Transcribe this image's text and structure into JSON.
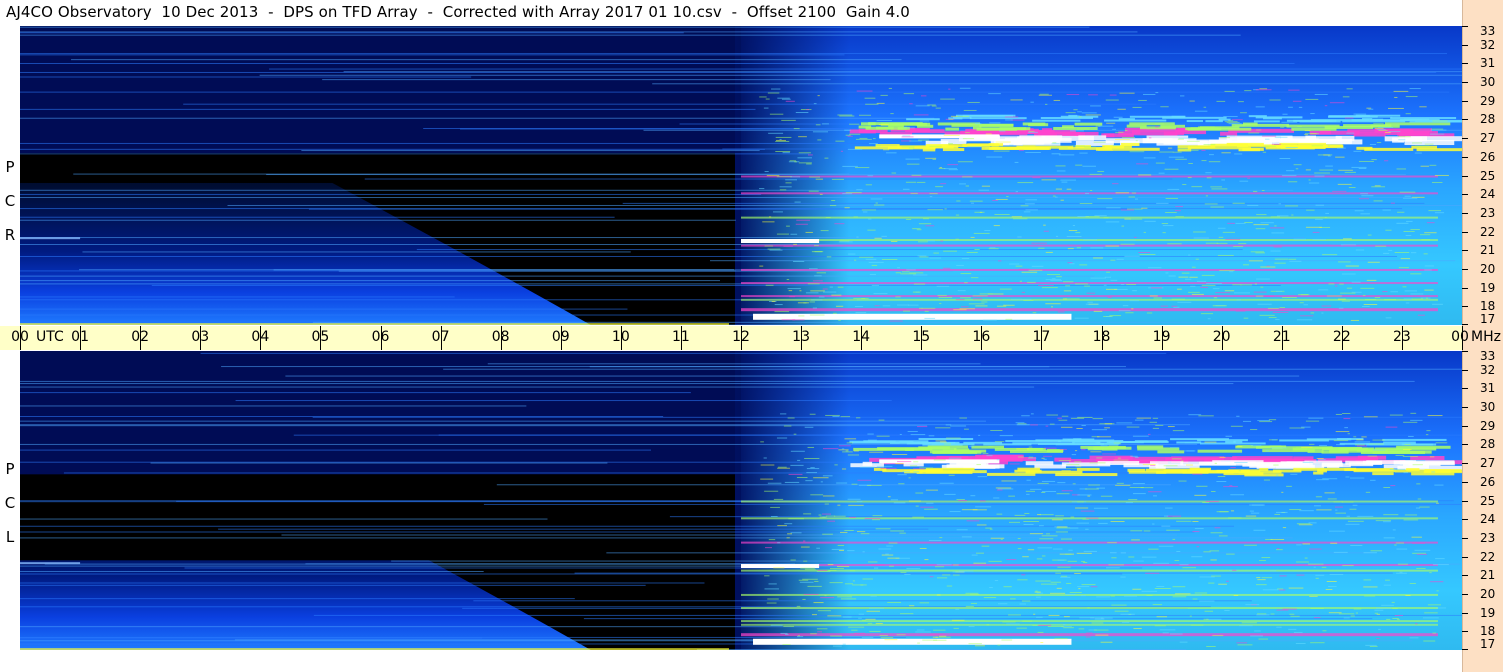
{
  "title": "AJ4CO Observatory  10 Dec 2013  -  DPS on TFD Array  -  Corrected with Array 2017 01 10.csv  -  Offset 2100  Gain 4.0",
  "chart_data": [
    {
      "type": "heatmap",
      "panel": "top",
      "polarization_label": [
        "R",
        "C",
        "P"
      ],
      "x_axis": {
        "label": "UTC",
        "ticks": [
          "00",
          "01",
          "02",
          "03",
          "04",
          "05",
          "06",
          "07",
          "08",
          "09",
          "10",
          "11",
          "12",
          "13",
          "14",
          "15",
          "16",
          "17",
          "18",
          "19",
          "20",
          "21",
          "22",
          "23",
          "00"
        ],
        "range_hours": [
          0,
          24
        ]
      },
      "y_axis": {
        "unit": "MHz",
        "ticks": [
          17,
          18,
          19,
          20,
          21,
          22,
          23,
          24,
          25,
          26,
          27,
          28,
          29,
          30,
          31,
          32,
          33
        ],
        "range_mhz": [
          17,
          33
        ]
      },
      "colormap": [
        "#000000",
        "#001a70",
        "#0033cc",
        "#1a66ff",
        "#33aaff",
        "#66ddff",
        "#aaff66",
        "#ffff33",
        "#ff44cc",
        "#ffffff"
      ]
    },
    {
      "type": "heatmap",
      "panel": "bottom",
      "polarization_label": [
        "L",
        "C",
        "P"
      ],
      "x_axis": {
        "label": "UTC",
        "ticks": [
          "00",
          "01",
          "02",
          "03",
          "04",
          "05",
          "06",
          "07",
          "08",
          "09",
          "10",
          "11",
          "12",
          "13",
          "14",
          "15",
          "16",
          "17",
          "18",
          "19",
          "20",
          "21",
          "22",
          "23",
          "00"
        ],
        "range_hours": [
          0,
          24
        ]
      },
      "y_axis": {
        "unit": "MHz",
        "ticks": [
          17,
          18,
          19,
          20,
          21,
          22,
          23,
          24,
          25,
          26,
          27,
          28,
          29,
          30,
          31,
          32,
          33
        ],
        "range_mhz": [
          17,
          33
        ]
      },
      "colormap": [
        "#000000",
        "#001a70",
        "#0033cc",
        "#1a66ff",
        "#33aaff",
        "#66ddff",
        "#aaff66",
        "#ffff33",
        "#ff44cc",
        "#ffffff"
      ]
    }
  ],
  "utc_axis": {
    "label": "UTC",
    "unit": "MHz",
    "hours": [
      "00",
      "01",
      "02",
      "03",
      "04",
      "05",
      "06",
      "07",
      "08",
      "09",
      "10",
      "11",
      "12",
      "13",
      "14",
      "15",
      "16",
      "17",
      "18",
      "19",
      "20",
      "21",
      "22",
      "23",
      "00"
    ]
  },
  "freq_ticks": [
    17,
    18,
    19,
    20,
    21,
    22,
    23,
    24,
    25,
    26,
    27,
    28,
    29,
    30,
    31,
    32,
    33
  ],
  "top_pol": [
    "R",
    "C",
    "P"
  ],
  "bottom_pol": [
    "L",
    "C",
    "P"
  ]
}
